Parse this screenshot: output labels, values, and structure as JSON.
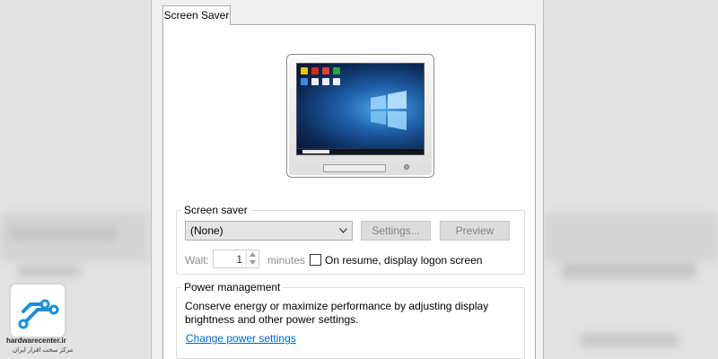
{
  "tabs": [
    {
      "label": "Screen Saver",
      "active": true
    }
  ],
  "screen_saver": {
    "group_title": "Screen saver",
    "selected_value": "(None)",
    "settings_label": "Settings...",
    "preview_label": "Preview",
    "wait_label": "Wait:",
    "wait_value": "1",
    "minutes_label": "minutes",
    "resume_label": "On resume, display logon screen",
    "resume_checked": false
  },
  "power": {
    "group_title": "Power management",
    "description": "Conserve energy or maximize performance by adjusting display brightness and other power settings.",
    "link_label": "Change power settings"
  },
  "watermark": {
    "site": "hardwarecenter.ir",
    "tagline": "مرکز سخت افزار ایران"
  },
  "colors": {
    "link": "#0066cc",
    "disabled_text": "#838383",
    "dialog_bg": "#f0f0f0"
  }
}
